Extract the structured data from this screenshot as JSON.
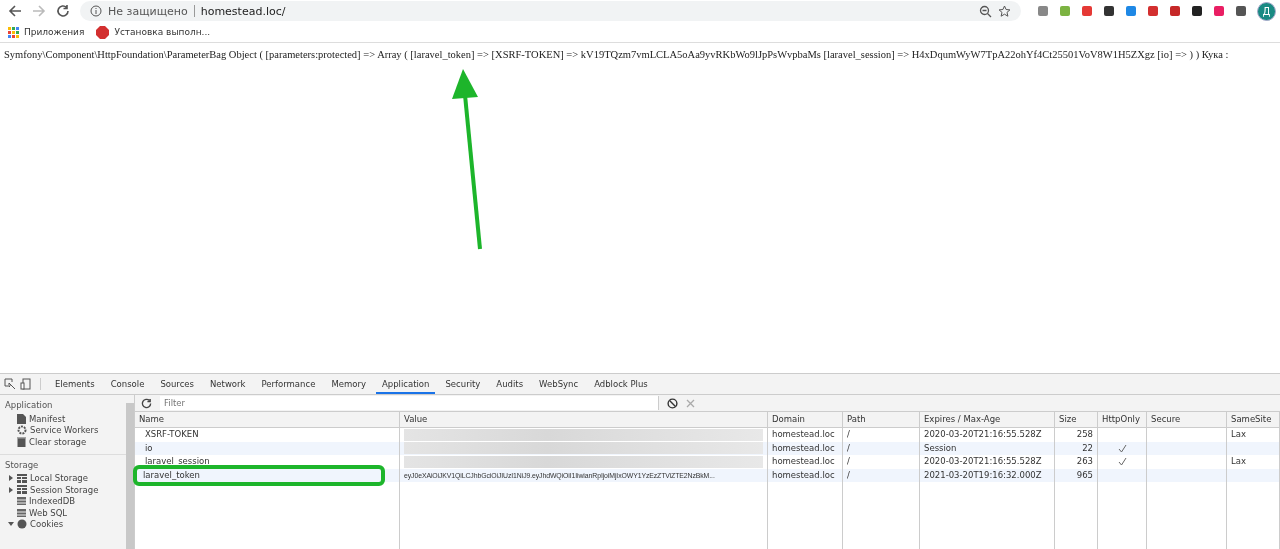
{
  "browser": {
    "security_label": "Не защищено",
    "url": "homestead.loc/",
    "avatar_letter": "Д"
  },
  "bookmarks": [
    {
      "label": "Приложения",
      "kind": "apps"
    },
    {
      "label": "Установка выполн...",
      "kind": "abp"
    }
  ],
  "page": {
    "text": "Symfony\\Component\\HttpFoundation\\ParameterBag Object ( [parameters:protected] => Array ( [laravel_token] => [XSRF-TOKEN] => kV19TQzm7vmLCLA5oAa9yvRKbWo9lJpPsWvpbaMs [laravel_session] => H4xDqumWyW7TpA22ohYf4Ct25501VoV8W1H5ZXgz [io] => ) ) Кука :"
  },
  "devtools": {
    "tabs": [
      {
        "label": "Elements",
        "selected": false
      },
      {
        "label": "Console",
        "selected": false
      },
      {
        "label": "Sources",
        "selected": false
      },
      {
        "label": "Network",
        "selected": false
      },
      {
        "label": "Performance",
        "selected": false
      },
      {
        "label": "Memory",
        "selected": false
      },
      {
        "label": "Application",
        "selected": true
      },
      {
        "label": "Security",
        "selected": false
      },
      {
        "label": "Audits",
        "selected": false
      },
      {
        "label": "WebSync",
        "selected": false
      },
      {
        "label": "Adblock Plus",
        "selected": false
      }
    ],
    "sidebar": [
      {
        "title": "Application",
        "items": [
          {
            "label": "Manifest",
            "kind": "file"
          },
          {
            "label": "Service Workers",
            "kind": "gear"
          },
          {
            "label": "Clear storage",
            "kind": "trash"
          }
        ]
      },
      {
        "title": "Storage",
        "items": [
          {
            "label": "Local Storage",
            "kind": "grid",
            "expanded": false
          },
          {
            "label": "Session Storage",
            "kind": "grid",
            "expanded": false
          },
          {
            "label": "IndexedDB",
            "kind": "db"
          },
          {
            "label": "Web SQL",
            "kind": "db"
          },
          {
            "label": "Cookies",
            "kind": "cookie",
            "expanded": true
          }
        ]
      }
    ],
    "filter": {
      "placeholder": "Filter"
    },
    "table": {
      "columns": [
        "Name",
        "Value",
        "Domain",
        "Path",
        "Expires / Max-Age",
        "Size",
        "HttpOnly",
        "Secure",
        "SameSite"
      ],
      "rows": [
        {
          "name": "XSRF-TOKEN",
          "value_blurred": true,
          "domain": "homestead.loc",
          "path": "/",
          "expires": "2020-03-20T21:16:55.528Z",
          "size": "258",
          "http_only": false,
          "same_site": "Lax",
          "highlighted": false
        },
        {
          "name": "io",
          "value_blurred": true,
          "domain": "homestead.loc",
          "path": "/",
          "expires": "Session",
          "size": "22",
          "http_only": true,
          "highlighted": false
        },
        {
          "name": "laravel_session",
          "value_blurred": true,
          "domain": "homestead.loc",
          "path": "/",
          "expires": "2020-03-20T21:16:55.528Z",
          "size": "263",
          "http_only": true,
          "same_site": "Lax",
          "highlighted": false
        },
        {
          "name": "laravel_token",
          "value": "eyJ0eXAiOiJKV1QiLCJhbGciOiJIUzI1NiJ9.eyJhdWQiOiI1IiwianRpIjoiMjIxOWY1YzEzZTViZTE2NzBkM...",
          "value_blurred": false,
          "domain": "homestead.loc",
          "path": "/",
          "expires": "2021-03-20T19:16:32.000Z",
          "size": "965",
          "http_only": false,
          "highlighted": true
        }
      ]
    }
  }
}
